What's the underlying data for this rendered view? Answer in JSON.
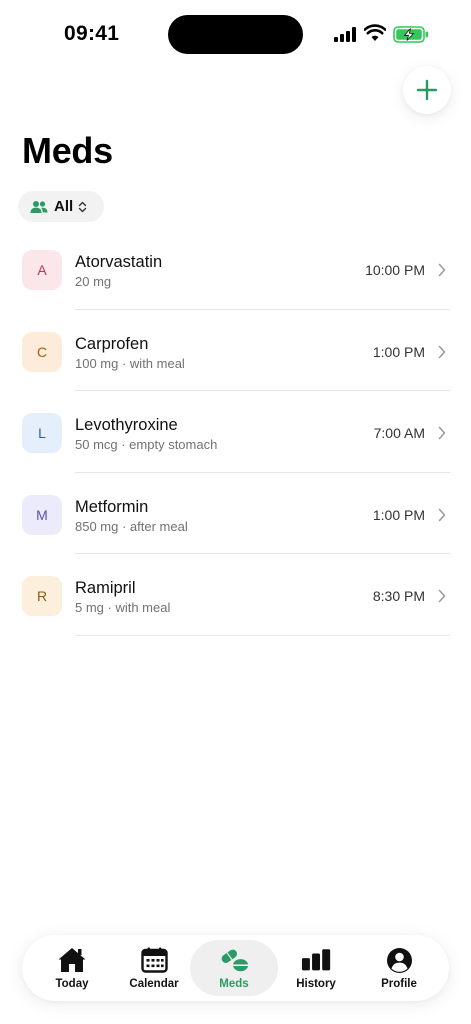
{
  "status_bar": {
    "time": "09:41"
  },
  "header": {
    "title": "Meds"
  },
  "filter": {
    "label": "All"
  },
  "colors": {
    "accent": "#2a9a66"
  },
  "meds": [
    {
      "initial": "A",
      "name": "Atorvastatin",
      "detail": "20 mg",
      "time": "10:00 PM",
      "bg": "#fbe6ea",
      "fg": "#b03a52"
    },
    {
      "initial": "C",
      "name": "Carprofen",
      "detail": "100 mg · with meal",
      "time": "1:00 PM",
      "bg": "#fcecd9",
      "fg": "#a85a12"
    },
    {
      "initial": "L",
      "name": "Levothyroxine",
      "detail": "50 mcg · empty stomach",
      "time": "7:00 AM",
      "bg": "#e5eefb",
      "fg": "#2d5fa3"
    },
    {
      "initial": "M",
      "name": "Metformin",
      "detail": "850 mg · after meal",
      "time": "1:00 PM",
      "bg": "#ecebfb",
      "fg": "#5a4fae"
    },
    {
      "initial": "R",
      "name": "Ramipril",
      "detail": "5 mg · with meal",
      "time": "8:30 PM",
      "bg": "#fcefdc",
      "fg": "#8a5a16"
    }
  ],
  "tabs": [
    {
      "label": "Today",
      "icon": "home-icon"
    },
    {
      "label": "Calendar",
      "icon": "calendar-icon"
    },
    {
      "label": "Meds",
      "icon": "pills-icon",
      "active": true
    },
    {
      "label": "History",
      "icon": "bar-chart-icon"
    },
    {
      "label": "Profile",
      "icon": "profile-icon"
    }
  ]
}
